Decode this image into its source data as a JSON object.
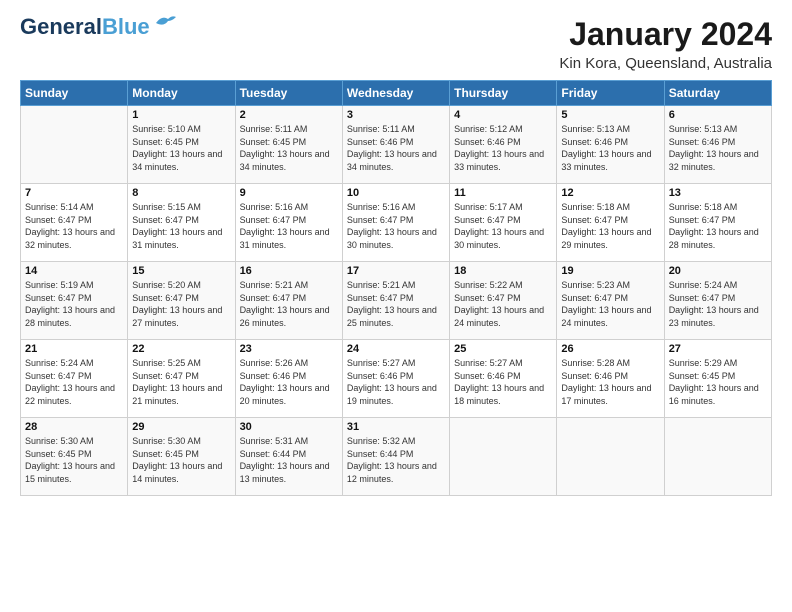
{
  "header": {
    "logo_line1": "General",
    "logo_line2": "Blue",
    "title": "January 2024",
    "subtitle": "Kin Kora, Queensland, Australia"
  },
  "days_of_week": [
    "Sunday",
    "Monday",
    "Tuesday",
    "Wednesday",
    "Thursday",
    "Friday",
    "Saturday"
  ],
  "weeks": [
    [
      {
        "day": "",
        "sunrise": "",
        "sunset": "",
        "daylight": ""
      },
      {
        "day": "1",
        "sunrise": "Sunrise: 5:10 AM",
        "sunset": "Sunset: 6:45 PM",
        "daylight": "Daylight: 13 hours and 34 minutes."
      },
      {
        "day": "2",
        "sunrise": "Sunrise: 5:11 AM",
        "sunset": "Sunset: 6:45 PM",
        "daylight": "Daylight: 13 hours and 34 minutes."
      },
      {
        "day": "3",
        "sunrise": "Sunrise: 5:11 AM",
        "sunset": "Sunset: 6:46 PM",
        "daylight": "Daylight: 13 hours and 34 minutes."
      },
      {
        "day": "4",
        "sunrise": "Sunrise: 5:12 AM",
        "sunset": "Sunset: 6:46 PM",
        "daylight": "Daylight: 13 hours and 33 minutes."
      },
      {
        "day": "5",
        "sunrise": "Sunrise: 5:13 AM",
        "sunset": "Sunset: 6:46 PM",
        "daylight": "Daylight: 13 hours and 33 minutes."
      },
      {
        "day": "6",
        "sunrise": "Sunrise: 5:13 AM",
        "sunset": "Sunset: 6:46 PM",
        "daylight": "Daylight: 13 hours and 32 minutes."
      }
    ],
    [
      {
        "day": "7",
        "sunrise": "Sunrise: 5:14 AM",
        "sunset": "Sunset: 6:47 PM",
        "daylight": "Daylight: 13 hours and 32 minutes."
      },
      {
        "day": "8",
        "sunrise": "Sunrise: 5:15 AM",
        "sunset": "Sunset: 6:47 PM",
        "daylight": "Daylight: 13 hours and 31 minutes."
      },
      {
        "day": "9",
        "sunrise": "Sunrise: 5:16 AM",
        "sunset": "Sunset: 6:47 PM",
        "daylight": "Daylight: 13 hours and 31 minutes."
      },
      {
        "day": "10",
        "sunrise": "Sunrise: 5:16 AM",
        "sunset": "Sunset: 6:47 PM",
        "daylight": "Daylight: 13 hours and 30 minutes."
      },
      {
        "day": "11",
        "sunrise": "Sunrise: 5:17 AM",
        "sunset": "Sunset: 6:47 PM",
        "daylight": "Daylight: 13 hours and 30 minutes."
      },
      {
        "day": "12",
        "sunrise": "Sunrise: 5:18 AM",
        "sunset": "Sunset: 6:47 PM",
        "daylight": "Daylight: 13 hours and 29 minutes."
      },
      {
        "day": "13",
        "sunrise": "Sunrise: 5:18 AM",
        "sunset": "Sunset: 6:47 PM",
        "daylight": "Daylight: 13 hours and 28 minutes."
      }
    ],
    [
      {
        "day": "14",
        "sunrise": "Sunrise: 5:19 AM",
        "sunset": "Sunset: 6:47 PM",
        "daylight": "Daylight: 13 hours and 28 minutes."
      },
      {
        "day": "15",
        "sunrise": "Sunrise: 5:20 AM",
        "sunset": "Sunset: 6:47 PM",
        "daylight": "Daylight: 13 hours and 27 minutes."
      },
      {
        "day": "16",
        "sunrise": "Sunrise: 5:21 AM",
        "sunset": "Sunset: 6:47 PM",
        "daylight": "Daylight: 13 hours and 26 minutes."
      },
      {
        "day": "17",
        "sunrise": "Sunrise: 5:21 AM",
        "sunset": "Sunset: 6:47 PM",
        "daylight": "Daylight: 13 hours and 25 minutes."
      },
      {
        "day": "18",
        "sunrise": "Sunrise: 5:22 AM",
        "sunset": "Sunset: 6:47 PM",
        "daylight": "Daylight: 13 hours and 24 minutes."
      },
      {
        "day": "19",
        "sunrise": "Sunrise: 5:23 AM",
        "sunset": "Sunset: 6:47 PM",
        "daylight": "Daylight: 13 hours and 24 minutes."
      },
      {
        "day": "20",
        "sunrise": "Sunrise: 5:24 AM",
        "sunset": "Sunset: 6:47 PM",
        "daylight": "Daylight: 13 hours and 23 minutes."
      }
    ],
    [
      {
        "day": "21",
        "sunrise": "Sunrise: 5:24 AM",
        "sunset": "Sunset: 6:47 PM",
        "daylight": "Daylight: 13 hours and 22 minutes."
      },
      {
        "day": "22",
        "sunrise": "Sunrise: 5:25 AM",
        "sunset": "Sunset: 6:47 PM",
        "daylight": "Daylight: 13 hours and 21 minutes."
      },
      {
        "day": "23",
        "sunrise": "Sunrise: 5:26 AM",
        "sunset": "Sunset: 6:46 PM",
        "daylight": "Daylight: 13 hours and 20 minutes."
      },
      {
        "day": "24",
        "sunrise": "Sunrise: 5:27 AM",
        "sunset": "Sunset: 6:46 PM",
        "daylight": "Daylight: 13 hours and 19 minutes."
      },
      {
        "day": "25",
        "sunrise": "Sunrise: 5:27 AM",
        "sunset": "Sunset: 6:46 PM",
        "daylight": "Daylight: 13 hours and 18 minutes."
      },
      {
        "day": "26",
        "sunrise": "Sunrise: 5:28 AM",
        "sunset": "Sunset: 6:46 PM",
        "daylight": "Daylight: 13 hours and 17 minutes."
      },
      {
        "day": "27",
        "sunrise": "Sunrise: 5:29 AM",
        "sunset": "Sunset: 6:45 PM",
        "daylight": "Daylight: 13 hours and 16 minutes."
      }
    ],
    [
      {
        "day": "28",
        "sunrise": "Sunrise: 5:30 AM",
        "sunset": "Sunset: 6:45 PM",
        "daylight": "Daylight: 13 hours and 15 minutes."
      },
      {
        "day": "29",
        "sunrise": "Sunrise: 5:30 AM",
        "sunset": "Sunset: 6:45 PM",
        "daylight": "Daylight: 13 hours and 14 minutes."
      },
      {
        "day": "30",
        "sunrise": "Sunrise: 5:31 AM",
        "sunset": "Sunset: 6:44 PM",
        "daylight": "Daylight: 13 hours and 13 minutes."
      },
      {
        "day": "31",
        "sunrise": "Sunrise: 5:32 AM",
        "sunset": "Sunset: 6:44 PM",
        "daylight": "Daylight: 13 hours and 12 minutes."
      },
      {
        "day": "",
        "sunrise": "",
        "sunset": "",
        "daylight": ""
      },
      {
        "day": "",
        "sunrise": "",
        "sunset": "",
        "daylight": ""
      },
      {
        "day": "",
        "sunrise": "",
        "sunset": "",
        "daylight": ""
      }
    ]
  ]
}
